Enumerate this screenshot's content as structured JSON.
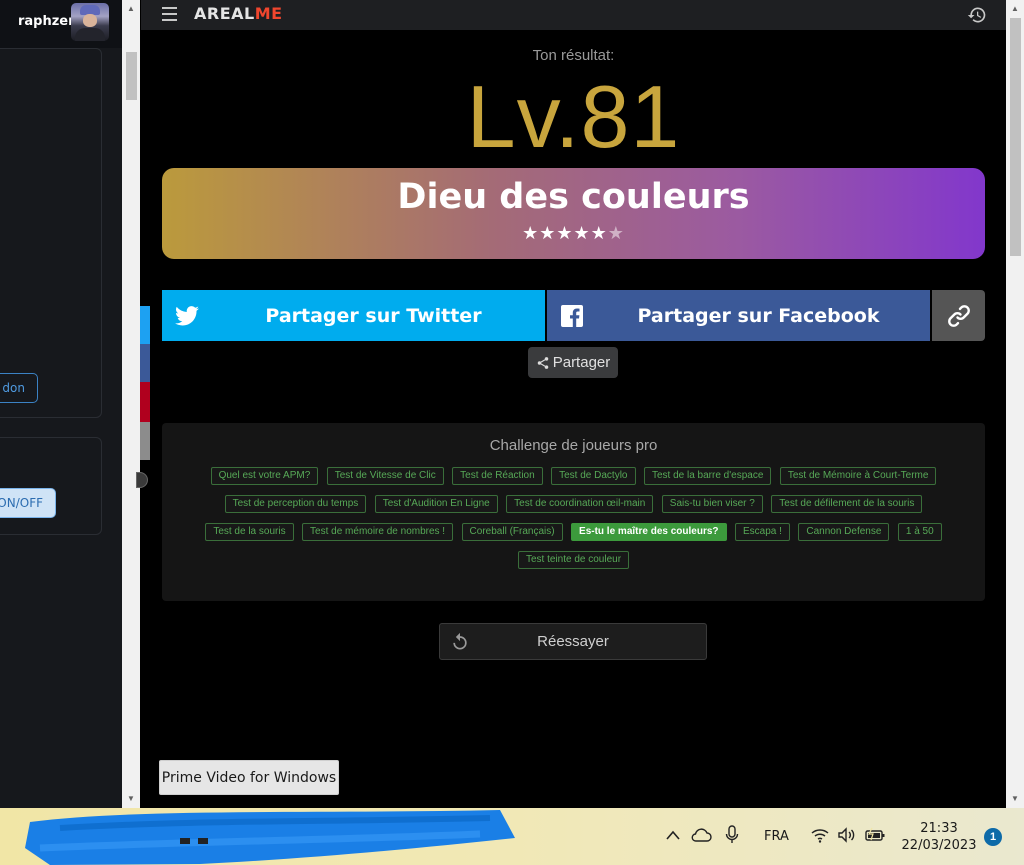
{
  "left_pane": {
    "username": "raphzer",
    "donate_label": "don",
    "onoff_label": "ON/OFF"
  },
  "header": {
    "logo_part1": "AREAL",
    "logo_part2": "ME"
  },
  "result": {
    "label": "Ton résultat:",
    "level": "Lv.81",
    "title": "Dieu des couleurs",
    "stars_full": "★★★★★",
    "stars_empty": "★",
    "rating": 5,
    "rating_max": 6
  },
  "share": {
    "twitter_label": "Partager sur Twitter",
    "facebook_label": "Partager sur Facebook",
    "share_label": "Partager"
  },
  "challenge": {
    "title": "Challenge de joueurs pro",
    "tags": [
      "Quel est votre APM?",
      "Test de Vitesse de Clic",
      "Test de Réaction",
      "Test de Dactylo",
      "Test de la barre d'espace",
      "Test de Mémoire à Court-Terme",
      "Test de perception du temps",
      "Test d'Audition En Ligne",
      "Test de coordination œil-main",
      "Sais-tu bien viser ?",
      "Test de défilement de la souris",
      "Test de la souris",
      "Test de mémoire de nombres !",
      "Coreball (Français)",
      "Es-tu le maître des couleurs?",
      "Escapa !",
      "Cannon Defense",
      "1 à 50",
      "Test teinte de couleur"
    ],
    "active_tag": "Es-tu le maître des couleurs?"
  },
  "retry_label": "Réessayer",
  "toast": "Prime Video for Windows",
  "taskbar": {
    "language": "FRA",
    "time": "21:33",
    "date": "22/03/2023",
    "notification_count": "1"
  },
  "colors": {
    "level_gold": "#c8a53d",
    "twitter": "#00acee",
    "facebook": "#3b5998",
    "logo_accent": "#f0462e",
    "tag_green": "#57a957"
  }
}
